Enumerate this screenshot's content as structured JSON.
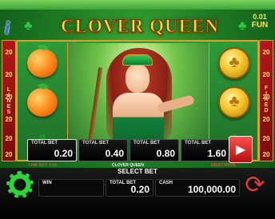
{
  "header": {
    "title": "CLOVER QUEEN",
    "fun_balance": "0.01",
    "fun_currency": "FUN"
  },
  "side": {
    "left_numbers": [
      "20",
      "20",
      "20",
      "20",
      "20",
      "20"
    ],
    "right_numbers": [
      "20",
      "20",
      "20",
      "20",
      "20",
      "20"
    ],
    "left_word": "LINES",
    "right_word": "FIXED"
  },
  "symbols": {
    "reel1": [
      "peach",
      "peach",
      "clover"
    ],
    "reel5": [
      "coin",
      "coin",
      "clover"
    ]
  },
  "bet_selector": {
    "label": "TOTAL BET",
    "options": [
      "0.20",
      "0.40",
      "0.80",
      "1.60"
    ],
    "selected": "0.20"
  },
  "notes": {
    "line_bet": "LINE BET: 0.01",
    "game_name": "CLOVER QUEEN",
    "demo_mode": "DEMO MODE"
  },
  "bottom_bar": {
    "select_bet": "SELECT BET",
    "win_label": "WIN",
    "win_value": "",
    "total_bet_label": "TOTAL BET",
    "total_bet_value": "0.20",
    "cash_label": "CASH",
    "cash_value": "100,000.00"
  },
  "colors": {
    "accent_gold": "#d8a12a",
    "title_gold": "#ffd84a",
    "side_red": "#b21818",
    "gear_green": "#2fd43a",
    "autoplay_red": "#e23a3a"
  }
}
